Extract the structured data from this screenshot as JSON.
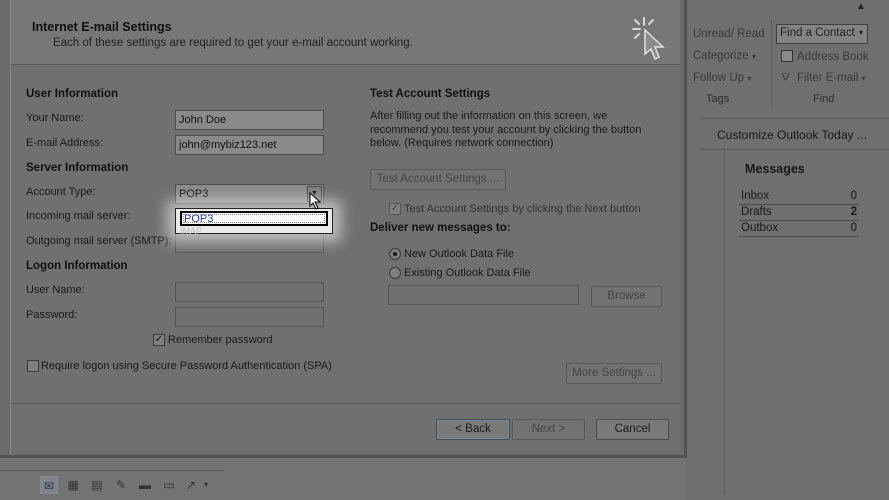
{
  "background": {
    "ribbon": {
      "unread_read": "Unread/ Read",
      "categorize": "Categorize",
      "follow_up": "Follow Up",
      "group_tags": "Tags",
      "find_contact": "Find a Contact",
      "address_book": "Address Book",
      "filter_email": "Filter E-mail",
      "group_find": "Find"
    },
    "customize_link": "Customize Outlook Today ...",
    "messages": {
      "title": "Messages",
      "rows": [
        {
          "name": "Inbox",
          "count": "0"
        },
        {
          "name": "Drafts",
          "count": "2"
        },
        {
          "name": "Outbox",
          "count": "0"
        }
      ]
    }
  },
  "dialog": {
    "title": "Internet E-mail Settings",
    "subtitle": "Each of these settings are required to get your e-mail account working.",
    "user_info": {
      "heading": "User Information",
      "name_label": "Your Name:",
      "name_value": "John Doe",
      "email_label": "E-mail Address:",
      "email_value": "john@mybiz123.net"
    },
    "server_info": {
      "heading": "Server Information",
      "account_type_label": "Account Type:",
      "account_type_value": "POP3",
      "dropdown_selected": "POP3",
      "dropdown_other": "IMAP",
      "incoming_label": "Incoming mail server:",
      "outgoing_label": "Outgoing mail server (SMTP):"
    },
    "logon_info": {
      "heading": "Logon Information",
      "user_label": "User Name:",
      "password_label": "Password:",
      "remember_label": "Remember password",
      "spa_label": "Require logon using Secure Password Authentication (SPA)"
    },
    "test": {
      "heading": "Test Account Settings",
      "description": "After filling out the information on this screen, we recommend you test your account by clicking the button below. (Requires network connection)",
      "button": "Test Account Settings ...",
      "next_check_label": "Test Account Settings by clicking the Next button"
    },
    "deliver": {
      "heading": "Deliver new messages to:",
      "new_file": "New Outlook Data File",
      "existing_file": "Existing Outlook Data File",
      "browse": "Browse"
    },
    "more_settings": "More Settings ...",
    "footer": {
      "back": "< Back",
      "next": "Next >",
      "cancel": "Cancel"
    }
  }
}
